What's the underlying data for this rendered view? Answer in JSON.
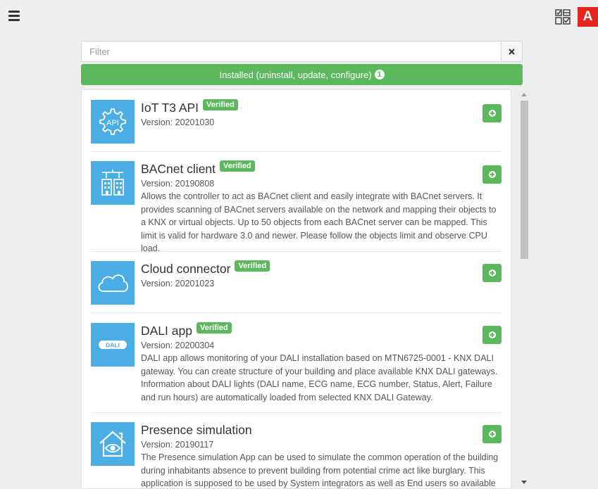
{
  "header": {
    "menu_icon": "hamburger-menu-icon",
    "checklist_icon": "checklist-icon",
    "user_initial": "A",
    "accent_color": "#e4261c"
  },
  "filter": {
    "placeholder": "Filter",
    "value": ""
  },
  "installed_bar": {
    "label": "Installed (uninstall, update, configure)",
    "count": "1",
    "color": "#5cb85c"
  },
  "apps": [
    {
      "title": "IoT T3 API",
      "verified": "Verified",
      "version": "Version: 20201030",
      "description": "",
      "icon": "api-gear-icon"
    },
    {
      "title": "BACnet client",
      "verified": "Verified",
      "version": "Version: 20190808",
      "description": "Allows the controller to act as BACnet client and easily integrate with BACnet servers. It provides scanning of BACnet servers available on the network and mapping their objects to a KNX or virtual objects. Up to 50 objects from each BACnet server can be mapped. This limit is valid for hardware 3.0 and newer. Please follow the objects limit and observe CPU load.",
      "icon": "building-network-icon"
    },
    {
      "title": "Cloud connector",
      "verified": "Verified",
      "version": "Version: 20201023",
      "description": "",
      "icon": "cloud-icon"
    },
    {
      "title": "DALI app",
      "verified": "Verified",
      "version": "Version: 20200304",
      "description": "DALI app allows monitoring of your DALI installation based on MTN6725-0001 - KNX DALI gateway. You can create structure of your building and place available KNX DALI gateways. Information about DALI lights (DALI name, ECG name, ECG number, Status, Alert, Failure and run hours) are automatically loaded from selected KNX DALI Gateway.",
      "icon": "dali-logo-icon",
      "icon_text": "DALI"
    },
    {
      "title": "Presence simulation",
      "verified": "",
      "version": "Version: 20190117",
      "description": "The Presence simulation App can be used to simulate the common operation of the building during inhabitants absence to prevent building from potential crime act like burglary. This application is supposed to be used by System integrators as well as End users so available",
      "icon": "house-eye-icon"
    }
  ]
}
